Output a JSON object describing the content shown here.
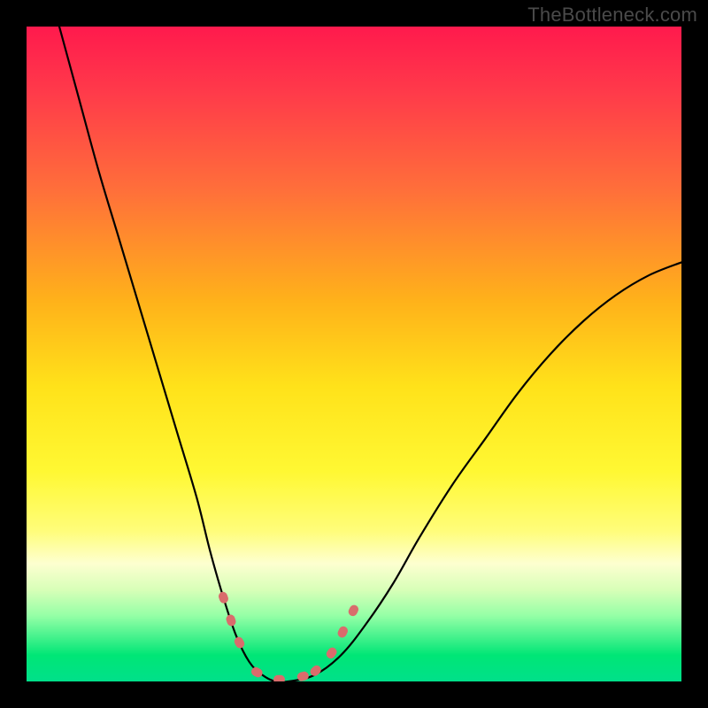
{
  "attribution": "TheBottleneck.com",
  "chart_data": {
    "type": "line",
    "title": "",
    "xlabel": "",
    "ylabel": "",
    "xlim": [
      0,
      100
    ],
    "ylim": [
      0,
      100
    ],
    "grid": false,
    "series": [
      {
        "name": "bottleneck-curve",
        "x": [
          5,
          8,
          11,
          14,
          17,
          20,
          23,
          26,
          28,
          30,
          32,
          34,
          36,
          38,
          40,
          44,
          48,
          52,
          56,
          60,
          65,
          70,
          75,
          80,
          85,
          90,
          95,
          100
        ],
        "y": [
          100,
          89,
          78,
          68,
          58,
          48,
          38,
          28,
          20,
          13,
          7,
          3,
          1,
          0,
          0,
          1,
          4,
          9,
          15,
          22,
          30,
          37,
          44,
          50,
          55,
          59,
          62,
          64
        ]
      }
    ],
    "dashed_overlay": {
      "name": "highlight-range",
      "color": "#d96c6c",
      "segments": [
        {
          "x": [
            30,
            31,
            32,
            33,
            34
          ],
          "y": [
            13,
            10,
            7,
            5,
            3
          ]
        },
        {
          "x": [
            35,
            37,
            39,
            41,
            43
          ],
          "y": [
            1.5,
            0.5,
            0.3,
            0.5,
            1
          ]
        },
        {
          "x": [
            44,
            45.5,
            47,
            48.5,
            50
          ],
          "y": [
            1.5,
            3,
            5,
            8,
            11
          ]
        }
      ]
    },
    "background_gradient": {
      "stops": [
        {
          "pct": 0,
          "color": "#ff1a4d"
        },
        {
          "pct": 25,
          "color": "#ff6f3a"
        },
        {
          "pct": 55,
          "color": "#ffe21a"
        },
        {
          "pct": 82,
          "color": "#fdffd0"
        },
        {
          "pct": 96,
          "color": "#00e676"
        },
        {
          "pct": 100,
          "color": "#00e08a"
        }
      ]
    }
  }
}
